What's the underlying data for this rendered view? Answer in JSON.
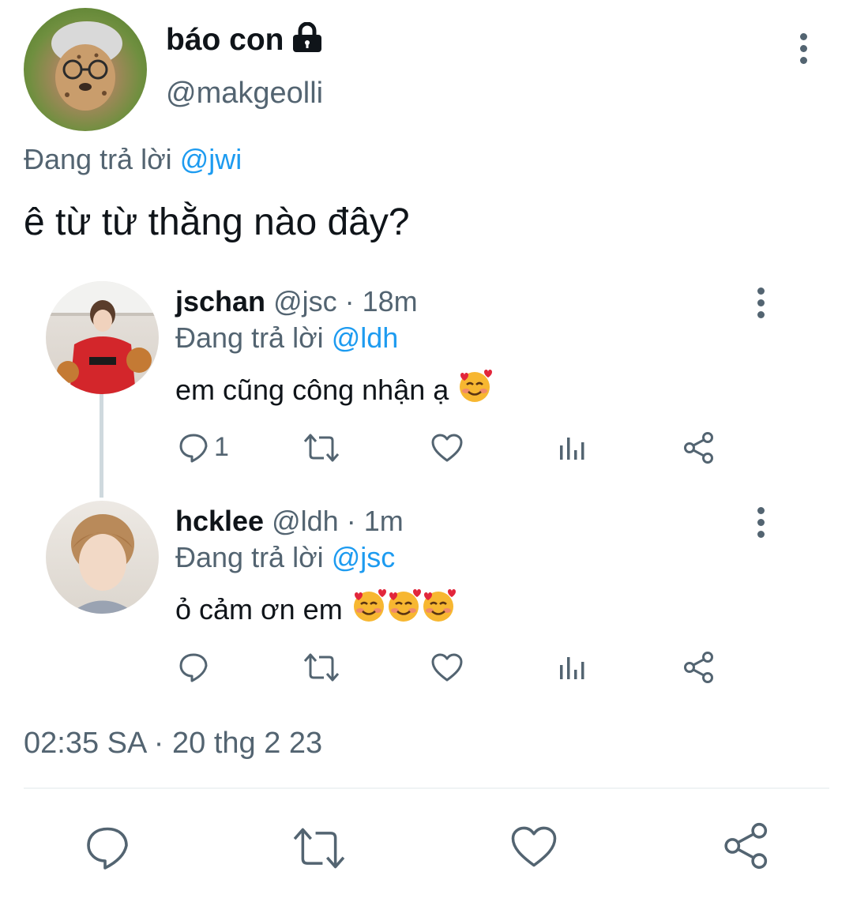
{
  "main_tweet": {
    "display_name": "báo con",
    "handle": "@makgeolli",
    "replying_prefix": "Đang trả lời",
    "replying_to": "@jwi",
    "text": "ê từ từ thằng nào đây?",
    "timestamp": "02:35 SA · 20 thg 2 23",
    "locked": true
  },
  "replies": [
    {
      "display_name": "jschan",
      "handle": "@jsc",
      "time": "· 18m",
      "replying_prefix": "Đang trả lời",
      "replying_to": "@ldh",
      "text": "em cũng công nhận ạ",
      "emoji_count": 1,
      "reply_count": "1"
    },
    {
      "display_name": "hcklee",
      "handle": "@ldh",
      "time": "· 1m",
      "replying_prefix": "Đang trả lời",
      "replying_to": "@jsc",
      "text": "ỏ cảm ơn em",
      "emoji_count": 3,
      "reply_count": ""
    }
  ],
  "icons": {
    "reply": "reply-icon",
    "retweet": "retweet-icon",
    "like": "heart-icon",
    "analytics": "analytics-icon",
    "share": "share-icon",
    "more": "more-vertical-icon",
    "lock": "lock-icon",
    "emoji": "smiling-face-with-hearts-emoji"
  },
  "colors": {
    "text": "#0f1419",
    "secondary": "#536471",
    "accent": "#1d9bf0",
    "thread_line": "#cfd9de",
    "divider": "#eff3f4"
  }
}
